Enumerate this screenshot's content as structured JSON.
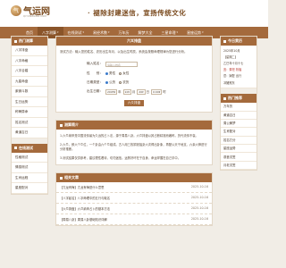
{
  "header": {
    "logo_glyph": "气",
    "logo_text": "气运网",
    "logo_domain": "QIYUNWANG.COM",
    "slogan": "· 褪除封建迷信，宣扬传统文化"
  },
  "nav": [
    {
      "label": "首页",
      "has_chevron": false,
      "active": false
    },
    {
      "label": "八字测算",
      "has_chevron": true,
      "active": true
    },
    {
      "label": "在线测试",
      "has_chevron": true,
      "active": false
    },
    {
      "label": "易经术数",
      "has_chevron": true,
      "active": false
    },
    {
      "label": "万年历",
      "has_chevron": false,
      "active": false
    },
    {
      "label": "解梦大全",
      "has_chevron": false,
      "active": false
    },
    {
      "label": "三星命理",
      "has_chevron": true,
      "active": false
    },
    {
      "label": "星座运势",
      "has_chevron": true,
      "active": false
    }
  ],
  "left_sidebar": {
    "heading": "热门测算",
    "items": [
      "八字排盘",
      "八字命格",
      "八字合婚",
      "九星命盘",
      "紫微斗数",
      "生日运势",
      "称骨算命",
      "姓名测试",
      "黄道吉日"
    ],
    "heading2": "在线测试",
    "items2": [
      "性格测试",
      "情感测试",
      "生肖运程",
      "星座配对"
    ]
  },
  "main": {
    "form_title": "六爻排盘",
    "intro": "测试方法：输入您的姓名、农历出生年月，以及出生时辰，系统会按照命理规律为您进行分析。",
    "name_label": "输入姓名：",
    "name_placeholder": "请输入姓名",
    "gender_label": "性　　别：",
    "gender_options": [
      "男性",
      "女性"
    ],
    "gender_selected": "男性",
    "calendar_label": "日期类型：",
    "calendar_options": [
      "公历",
      "农历"
    ],
    "calendar_selected": "公历",
    "birth_label": "出生日期：",
    "year": "2005",
    "year_unit": "年",
    "month": "10",
    "month_unit": "月",
    "day": "20",
    "day_unit": "日",
    "hour": "0:00",
    "hour_unit": "时",
    "submit_label": "六爻排盘",
    "intro_title": "测算简介",
    "paragraphs": [
      "1.六爻纳甲是中国流传最为久远的占卜法，源于周易八卦。六爻排盘以其占断精准而著称，历代流传不衰。",
      "2.六爻，即六个爻位，一个卦由六个爻组成。古人用三枚铜钱摇卦六次得出卦象，再配以天干地支、六亲六神进行分析推断。",
      "3.测试结果仅供参考，建议理性看待，切勿迷信。运势好坏在于自身，命运掌握在自己手中。"
    ],
    "articles_title": "相关文章",
    "articles": [
      {
        "title": "【亢龙有悔】亢龙有悔是什么意思",
        "date": "2025-10-16"
      },
      {
        "title": "【八字起名】八字命理中的五行与取名",
        "date": "2025-10-16"
      },
      {
        "title": "【六爻排盘】六爻纳甲占卜的基本方法",
        "date": "2025-10-16"
      },
      {
        "title": "【周易八卦】周易八卦基础知识详解",
        "date": "2025-10-16"
      }
    ]
  },
  "right_sidebar": {
    "heading": "今日黄历",
    "calendar_lines": [
      {
        "text": "2025年10月",
        "red": false
      },
      {
        "text": "【星期二】",
        "red": false
      },
      {
        "text": "乙巳年十月十七",
        "red": false
      },
      {
        "text": "宜：祭祀 祈福",
        "red": true
      },
      {
        "text": "忌：嫁娶 出行",
        "red": false
      },
      {
        "text": "冲猪煞东",
        "red": false
      }
    ],
    "heading2": "热门推荐",
    "items": [
      "万年历",
      "黄道吉日",
      "周公解梦",
      "生肖配对",
      "姓名打分",
      "星座运势",
      "观音灵签",
      "月老灵签"
    ]
  }
}
